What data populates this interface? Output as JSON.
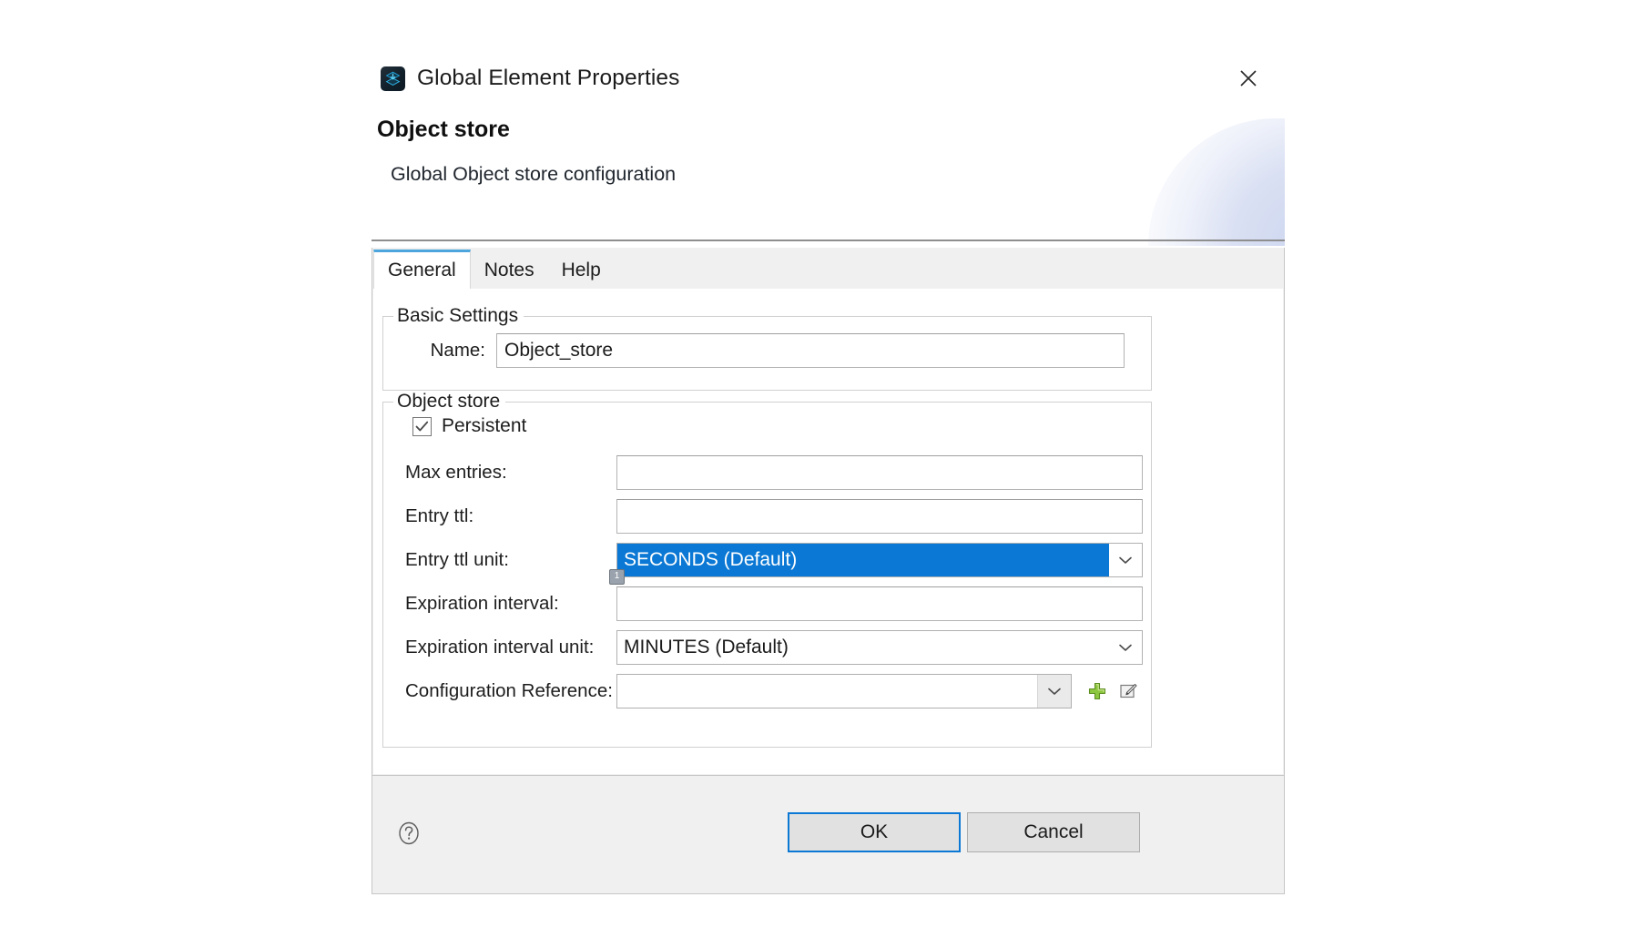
{
  "window": {
    "title": "Global Element Properties",
    "icon": "object-store-icon",
    "close_label": "close-icon"
  },
  "header": {
    "heading": "Object store",
    "subtitle": "Global Object store configuration"
  },
  "tabs": [
    {
      "label": "General",
      "active": true
    },
    {
      "label": "Notes",
      "active": false
    },
    {
      "label": "Help",
      "active": false
    }
  ],
  "groups": {
    "basic": {
      "title": "Basic Settings",
      "name_label": "Name:",
      "name_value": "Object_store"
    },
    "store": {
      "title": "Object store",
      "persistent_label": "Persistent",
      "persistent_checked": true,
      "fields": {
        "max_entries_label": "Max entries:",
        "max_entries_value": "",
        "entry_ttl_label": "Entry ttl:",
        "entry_ttl_value": "",
        "entry_ttl_unit_label": "Entry ttl unit:",
        "entry_ttl_unit_value": "SECONDS (Default)",
        "entry_ttl_unit_badge": "1",
        "expiration_interval_label": "Expiration interval:",
        "expiration_interval_value": "",
        "expiration_interval_unit_label": "Expiration interval unit:",
        "expiration_interval_unit_value": "MINUTES (Default)",
        "config_reference_label": "Configuration Reference:",
        "config_reference_value": "",
        "add_icon": "plus-icon",
        "edit_icon": "edit-icon"
      }
    }
  },
  "footer": {
    "help_icon": "help-icon",
    "ok_label": "OK",
    "cancel_label": "Cancel"
  },
  "colors": {
    "accent_blue": "#0a78d4",
    "tab_active_border": "#4ca6dd",
    "panel_gray": "#f0f0f0",
    "add_green": "#7cc04a"
  }
}
